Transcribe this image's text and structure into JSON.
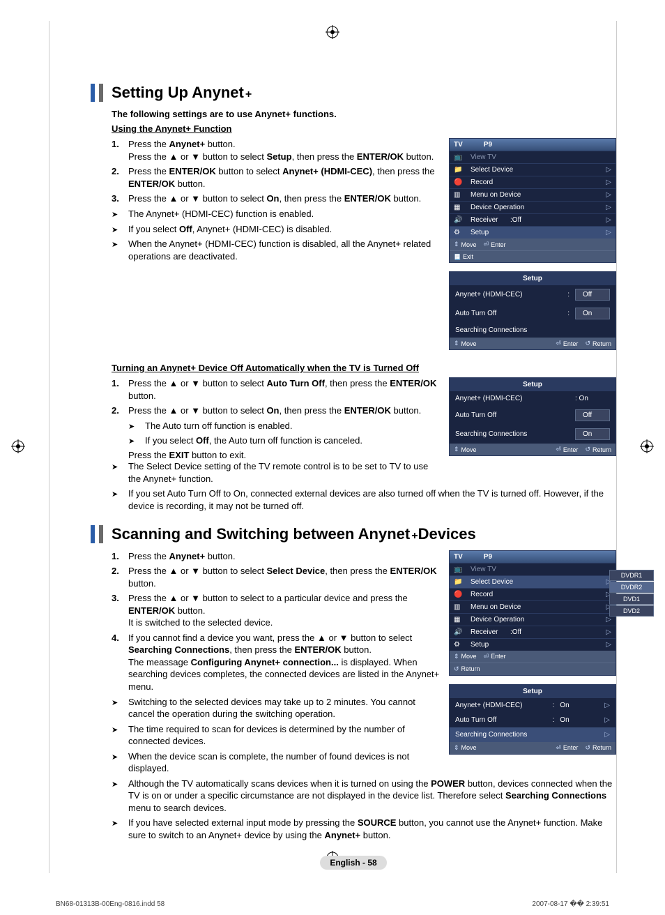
{
  "header1": "Setting Up Anynet",
  "header1_sup": "+",
  "intro": "The following settings are to use Anynet+ functions.",
  "sub1": "Using the Anynet+ Function",
  "s1_1a": "Press the ",
  "s1_1b": "Anynet+",
  "s1_1c": " button.",
  "s1_1d": "Press the ▲ or ▼ button to select ",
  "s1_1e": "Setup",
  "s1_1f": ", then press the ",
  "s1_1g": "ENTER/OK",
  "s1_1h": " button.",
  "s1_2a": "Press the ",
  "s1_2b": "ENTER/OK",
  "s1_2c": " button to select ",
  "s1_2d": "Anynet+ (HDMI-CEC)",
  "s1_2e": ", then press the ",
  "s1_2f": "ENTER/OK",
  "s1_2g": " button.",
  "s1_3a": "Press the ▲ or ▼ button to select ",
  "s1_3b": "On",
  "s1_3c": ", then press the ",
  "s1_3d": "ENTER/OK",
  "s1_3e": " button.",
  "s1_n1": "The Anynet+ (HDMI-CEC) function is enabled.",
  "s1_n2a": "If you select ",
  "s1_n2b": "Off",
  "s1_n2c": ", Anynet+ (HDMI-CEC) is disabled.",
  "s1_n3": "When the Anynet+ (HDMI-CEC) function is disabled, all the Anynet+ related operations are deactivated.",
  "sub2": "Turning an Anynet+ Device Off Automatically when the TV is Turned Off",
  "s2_1a": "Press the ▲ or ▼ button to select ",
  "s2_1b": "Auto Turn Off",
  "s2_1c": ", then press the ",
  "s2_1d": "ENTER/OK",
  "s2_1e": " button.",
  "s2_2a": "Press the ▲ or ▼ button to select ",
  "s2_2b": "On",
  "s2_2c": ", then press the ",
  "s2_2d": "ENTER/OK",
  "s2_2e": " button.",
  "s2_n1": "The Auto turn off function is enabled.",
  "s2_n2a": "If you select ",
  "s2_n2b": "Off",
  "s2_n2c": ", the Auto turn off function is canceled.",
  "s2_n3a": "Press the ",
  "s2_n3b": "EXIT",
  "s2_n3c": " button to exit.",
  "s2_n4": "The Select Device setting of the TV remote control is to be set to TV to use the Anynet+ function.",
  "s2_n5": "If you set Auto Turn Off to On, connected external devices are also turned off when the TV is turned off. However, if the device is recording, it may not be turned off.",
  "header2a": "Scanning and Switching between Anynet",
  "header2b": "+",
  "header2c": " Devices",
  "s3_1a": "Press the ",
  "s3_1b": "Anynet+",
  "s3_1c": " button.",
  "s3_2a": "Press the ▲ or ▼ button to select ",
  "s3_2b": "Select Device",
  "s3_2c": ", then press the ",
  "s3_2d": "ENTER/OK",
  "s3_2e": " button.",
  "s3_3a": "Press the ▲ or ▼ button to select to a particular device and press the ",
  "s3_3b": "ENTER/OK",
  "s3_3c": " button.",
  "s3_3d": "It is switched to the selected device.",
  "s3_4a": "If you cannot find a device you want, press the ▲ or ▼ button to select ",
  "s3_4b": "Searching Connections",
  "s3_4c": ", then press the ",
  "s3_4d": "ENTER/OK",
  "s3_4e": " button.",
  "s3_4f": "The meassage ",
  "s3_4g": "Configuring Anynet+ connection...",
  "s3_4h": " is displayed. When searching devices completes, the connected devices are listed in the Anynet+ menu.",
  "s3_n1": "Switching to the selected devices may take up to 2 minutes. You cannot cancel the operation during the switching operation.",
  "s3_n2": "The time required to scan for devices is determined by the number of connected devices.",
  "s3_n3": "When the device scan is complete, the number of found devices is not displayed.",
  "s3_n4a": "Although the TV automatically scans devices when it is turned on using the ",
  "s3_n4b": "POWER",
  "s3_n4c": " button, devices connected when the TV is on or under a specific circumstance are not displayed in the device list. Therefore select ",
  "s3_n4d": "Searching Connections",
  "s3_n4e": " menu to search devices.",
  "s3_n5a": "If you have selected external input mode by pressing the ",
  "s3_n5b": "SOURCE",
  "s3_n5c": " button, you cannot use the Anynet+ function. Make sure to switch to an Anynet+ device by using the ",
  "s3_n5d": "Anynet+",
  "s3_n5e": " button.",
  "osd": {
    "tv": "TV",
    "p9": "P9",
    "view_tv": "View TV",
    "select_device": "Select Device",
    "record": "Record",
    "menu_on_device": "Menu on Device",
    "device_operation": "Device Operation",
    "receiver": "Receiver",
    "rec_off": ":Off",
    "setup": "Setup",
    "move": "Move",
    "enter": "Enter",
    "exit": "Exit",
    "return": "Return",
    "anynet_cec": "Anynet+ (HDMI-CEC)",
    "auto_off": "Auto Turn Off",
    "searching": "Searching Connections",
    "off": "Off",
    "on": "On",
    "on_colon": ": On",
    "colon": ":",
    "dvdr1": "DVDR1",
    "dvdr2": "DVDR2",
    "dvd1": "DVD1",
    "dvd2": "DVD2"
  },
  "pagefoot": "English - 58",
  "docfoot_l": "BN68-01313B-00Eng-0816.indd   58",
  "docfoot_r": "2007-08-17   �� 2:39:51"
}
